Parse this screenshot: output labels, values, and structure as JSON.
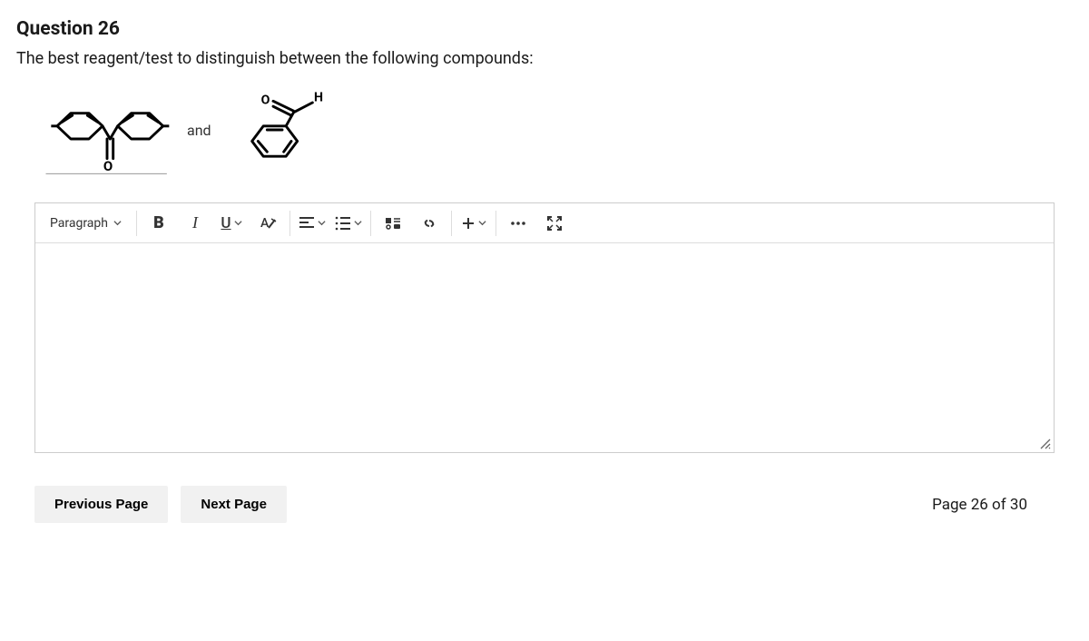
{
  "question": {
    "title": "Question 26",
    "prompt": "The best reagent/test to distinguish between the following compounds:",
    "joiner": "and"
  },
  "toolbar": {
    "paragraph_label": "Paragraph",
    "bold": "B",
    "italic": "I",
    "underline": "U"
  },
  "footer": {
    "prev": "Previous Page",
    "next": "Next Page",
    "page_info": "Page 26 of 30"
  }
}
